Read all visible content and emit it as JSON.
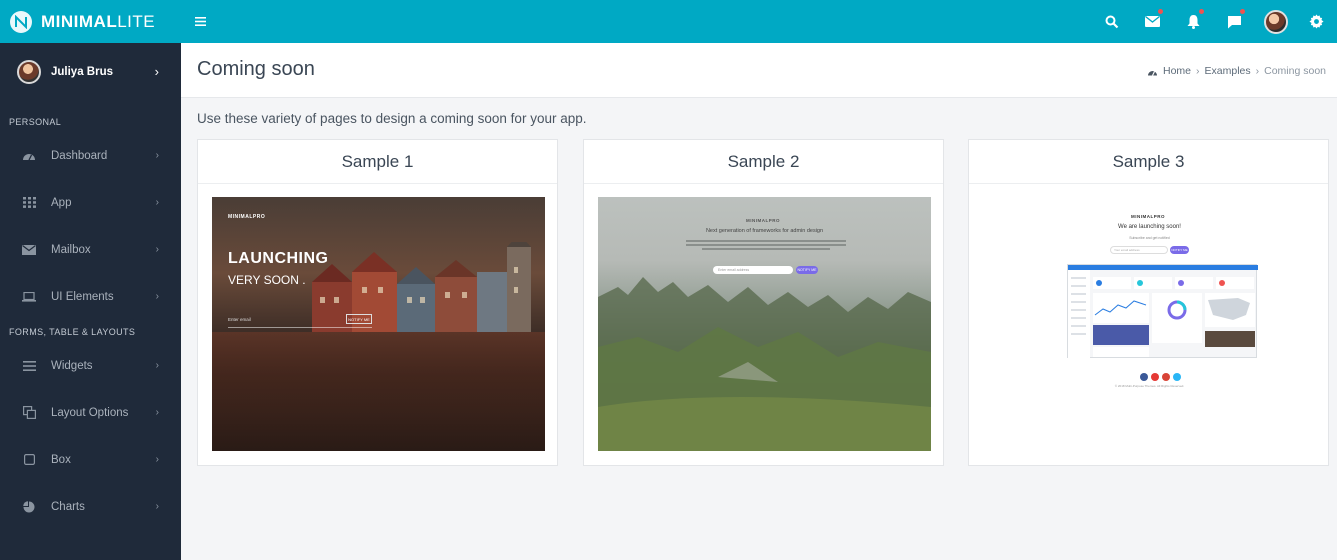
{
  "brand": {
    "name_bold": "MINIMAL",
    "name_light": "LITE"
  },
  "user": {
    "name": "Juliya Brus"
  },
  "sidebar": {
    "sections": [
      "PERSONAL",
      "FORMS, TABLE & LAYOUTS"
    ],
    "items": [
      {
        "label": "Dashboard",
        "icon": "dashboard-icon"
      },
      {
        "label": "App",
        "icon": "grid-icon"
      },
      {
        "label": "Mailbox",
        "icon": "envelope-icon"
      },
      {
        "label": "UI Elements",
        "icon": "laptop-icon"
      },
      {
        "label": "Widgets",
        "icon": "list-icon"
      },
      {
        "label": "Layout Options",
        "icon": "copy-icon"
      },
      {
        "label": "Box",
        "icon": "square-icon"
      },
      {
        "label": "Charts",
        "icon": "pie-chart-icon"
      }
    ]
  },
  "header": {
    "title": "Coming soon",
    "breadcrumb": [
      "Home",
      "Examples",
      "Coming soon"
    ]
  },
  "intro": "Use these variety of pages to design a coming soon for your app.",
  "samples": [
    {
      "title": "Sample 1",
      "preview": {
        "brand": "MINIMALPRO",
        "headline": "LAUNCHING",
        "subline": "VERY SOON .",
        "input_placeholder": "Enter email",
        "button": "NOTIFY ME"
      }
    },
    {
      "title": "Sample 2",
      "preview": {
        "brand": "MINIMALPRO",
        "subline": "Next generation of frameworks for admin design",
        "input_placeholder": "Enter email address",
        "button": "NOTIFY ME"
      }
    },
    {
      "title": "Sample 3",
      "preview": {
        "brand": "MINIMALPRO",
        "headline": "We are launching soon!",
        "subline": "Subscribe and get notified",
        "input_placeholder": "Your email address",
        "button": "NOTIFY ME",
        "copyright": "© 2018 Multi-Purpose Themes. All Rights Reserved."
      }
    }
  ],
  "colors": {
    "topbar": "#00a9c4",
    "sidebar": "#1f2a3a",
    "notification_dot": "#ef5350",
    "accent_purple": "#7a6be8"
  }
}
